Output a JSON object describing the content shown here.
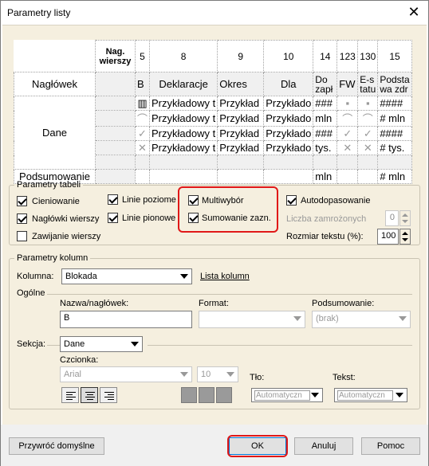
{
  "window": {
    "title": "Parametry listy",
    "close": "✕"
  },
  "grid": {
    "headers": [
      "Nag.\nwierszy",
      "5",
      "8",
      "9",
      "10",
      "14",
      "123",
      "130",
      "15"
    ],
    "col_titles": [
      "B",
      "Deklaracje",
      "Okres",
      "Dla",
      "Do zapł",
      "FW",
      "E-s tatu",
      "Podsta wa zdr"
    ],
    "row_labels": {
      "header": "Nagłówek",
      "data": "Dane",
      "summary": "Podsumowanie"
    },
    "data_rows": [
      [
        "Przykładowy t",
        "Przykład",
        "Przykłado",
        "###",
        "####"
      ],
      [
        "Przykładowy t",
        "Przykład",
        "Przykłado",
        "mln",
        "# mln"
      ],
      [
        "Przykładowy t",
        "Przykład",
        "Przykłado",
        "###",
        "####"
      ],
      [
        "Przykładowy t",
        "Przykład",
        "Przykłado",
        "tys.",
        "# tys."
      ]
    ],
    "summary": {
      "col14": "mln",
      "col15": "# mln"
    }
  },
  "table_params": {
    "legend": "Parametry tabeli",
    "cieniowanie": "Cieniowanie",
    "linie_poziome": "Linie poziome",
    "multiwybor": "Multiwybór",
    "autodopasowanie": "Autodopasowanie",
    "naglowki_wierszy": "Nagłówki wierszy",
    "linie_pionowe": "Linie pionowe",
    "sumowanie": "Sumowanie zazn.",
    "liczba_zamrozonych": "Liczba zamrożonych",
    "liczba_value": "0",
    "zawijanie": "Zawijanie wierszy",
    "rozmiar_tekstu": "Rozmiar tekstu (%):",
    "rozmiar_value": "100"
  },
  "column_params": {
    "legend": "Parametry kolumn",
    "kolumna_label": "Kolumna:",
    "kolumna_value": "Blokada",
    "lista_kolumn": "Lista kolumn",
    "ogolne": "Ogólne",
    "nazwa_label": "Nazwa/nagłówek:",
    "nazwa_value": "B",
    "format_label": "Format:",
    "format_value": "",
    "podsumowanie_label": "Podsumowanie:",
    "podsumowanie_value": "(brak)",
    "sekcja_label": "Sekcja:",
    "sekcja_value": "Dane",
    "czcionka_label": "Czcionka:",
    "font_value": "Arial",
    "size_value": "10",
    "tlo_label": "Tło:",
    "tlo_value": "Automatyczn",
    "tekst_label": "Tekst:",
    "tekst_value": "Automatyczn"
  },
  "footer": {
    "restore": "Przywróć domyślne",
    "ok": "OK",
    "cancel": "Anuluj",
    "help": "Pomoc"
  }
}
